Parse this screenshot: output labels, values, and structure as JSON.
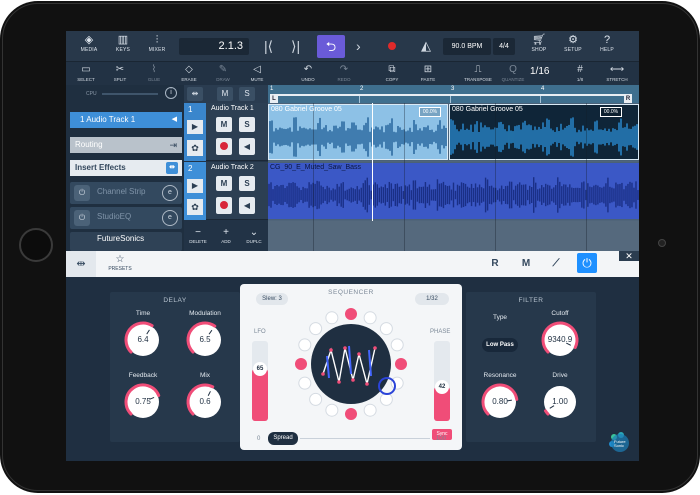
{
  "transport": {
    "media_label": "MEDIA",
    "keys_label": "KEYS",
    "mixer_label": "MIXER",
    "position": "2.1.3",
    "tempo": "90.0 BPM",
    "time_signature": "4/4",
    "shop_label": "SHOP",
    "setup_label": "SETUP",
    "help_label": "HELP"
  },
  "tools": {
    "select": "SELECT",
    "split": "SPLIT",
    "glue": "GLUE",
    "erase": "ERASE",
    "draw": "DRAW",
    "mute": "MUTE",
    "undo": "UNDO",
    "redo": "REDO",
    "copy": "COPY",
    "paste": "PASTE",
    "transpose": "TRANSPOSE",
    "quantize": "QUANTIZE",
    "quantize_value": "1/16",
    "grid": "1/8",
    "stretch": "STRETCH"
  },
  "inspector": {
    "cpu_label": "CPU",
    "info_icon": "i",
    "track_name": "1  Audio Track 1",
    "routing": "Routing",
    "insert_effects": "Insert Effects",
    "slots": [
      {
        "name": "Channel Strip"
      },
      {
        "name": "StudioEQ"
      },
      {
        "name": "FutureSonics"
      }
    ]
  },
  "track_tools": {
    "delete": "DELETE",
    "add": "ADD",
    "duplicate": "DUPLC"
  },
  "tracks": [
    {
      "number": "1",
      "name": "Audio Track 1",
      "mute": "M",
      "solo": "S"
    },
    {
      "number": "2",
      "name": "Audio Track 2",
      "mute": "M",
      "solo": "S"
    }
  ],
  "ruler": {
    "bars": [
      "1",
      "2",
      "3",
      "4"
    ],
    "left_locator": "L",
    "right_locator": "R"
  },
  "events": {
    "event_a": "080 Gabriel Groove 05",
    "event_b": "080 Gabriel Groove 05",
    "event_c": "CG_90_E_Muted_Saw_Bass",
    "gain_a": "00.0%",
    "gain_b": "00.0%"
  },
  "plugin": {
    "presets_label": "PRESETS",
    "tab_r": "R",
    "tab_m": "M"
  },
  "delay": {
    "title": "DELAY",
    "knobs": [
      {
        "label": "Time",
        "value": "6.4"
      },
      {
        "label": "Modulation",
        "value": "6.5"
      },
      {
        "label": "Feedback",
        "value": "0.75"
      },
      {
        "label": "Mix",
        "value": "0.6"
      }
    ]
  },
  "sequencer": {
    "title": "SEQUENCER",
    "slew": "Slew: 3",
    "rate": "1/32",
    "lfo_label": "LFO",
    "lfo_value": "65",
    "phase_label": "PHASE",
    "phase_value": "42",
    "sync_label": "Sync",
    "spread_label": "Spread",
    "spread_min": "0",
    "spread_max": "100"
  },
  "filter": {
    "title": "FILTER",
    "type_label": "Type",
    "type_value": "Low Pass",
    "knobs": [
      {
        "label": "Cutoff",
        "value": "9340.9"
      },
      {
        "label": "Resonance",
        "value": "0.80"
      },
      {
        "label": "Drive",
        "value": "1.00"
      }
    ]
  },
  "brand": {
    "text_line1": "Future",
    "text_line2": "Sonic"
  },
  "colors": {
    "accent_blue": "#3e8fd8",
    "cycle_purple": "#6a5bd8",
    "record_red": "#e02a2a",
    "knob_pink": "#f04d78"
  }
}
